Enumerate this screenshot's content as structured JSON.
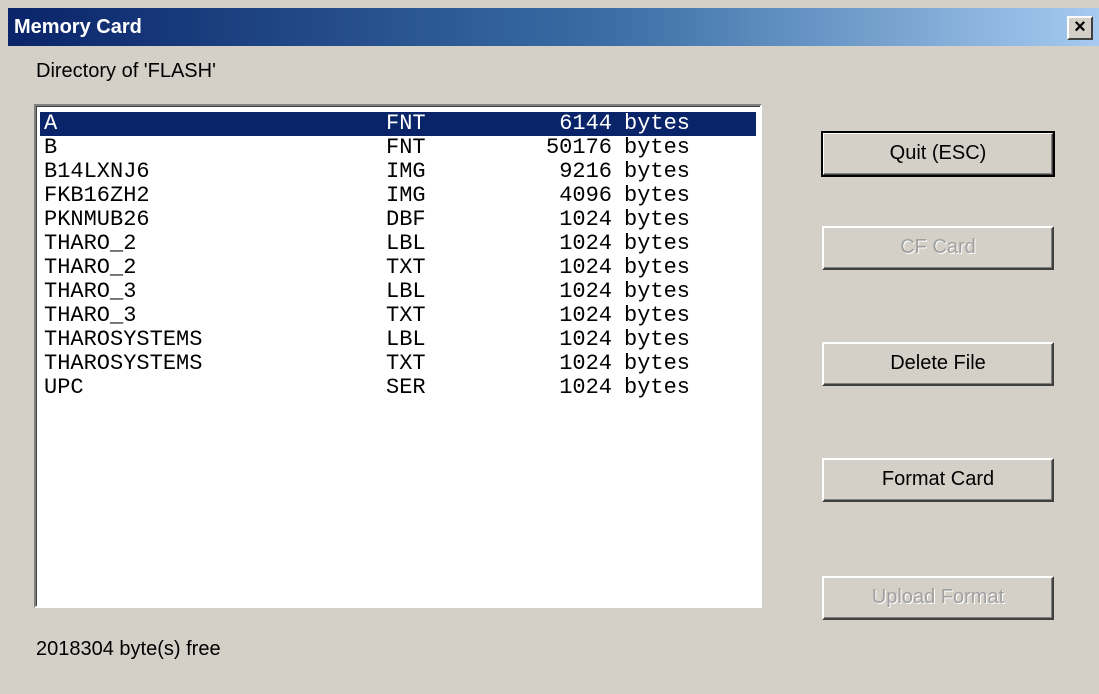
{
  "window": {
    "title": "Memory Card",
    "close_glyph": "×"
  },
  "directory_label": "Directory of 'FLASH'",
  "files": [
    {
      "name": "A",
      "ext": "FNT",
      "size": "6144",
      "unit": "bytes"
    },
    {
      "name": "B",
      "ext": "FNT",
      "size": "50176",
      "unit": "bytes"
    },
    {
      "name": "B14LXNJ6",
      "ext": "IMG",
      "size": "9216",
      "unit": "bytes"
    },
    {
      "name": "FKB16ZH2",
      "ext": "IMG",
      "size": "4096",
      "unit": "bytes"
    },
    {
      "name": "PKNMUB26",
      "ext": "DBF",
      "size": "1024",
      "unit": "bytes"
    },
    {
      "name": "THARO_2",
      "ext": "LBL",
      "size": "1024",
      "unit": "bytes"
    },
    {
      "name": "THARO_2",
      "ext": "TXT",
      "size": "1024",
      "unit": "bytes"
    },
    {
      "name": "THARO_3",
      "ext": "LBL",
      "size": "1024",
      "unit": "bytes"
    },
    {
      "name": "THARO_3",
      "ext": "TXT",
      "size": "1024",
      "unit": "bytes"
    },
    {
      "name": "THAROSYSTEMS",
      "ext": "LBL",
      "size": "1024",
      "unit": "bytes"
    },
    {
      "name": "THAROSYSTEMS",
      "ext": "TXT",
      "size": "1024",
      "unit": "bytes"
    },
    {
      "name": "UPC",
      "ext": "SER",
      "size": "1024",
      "unit": "bytes"
    }
  ],
  "buttons": {
    "quit": "Quit (ESC)",
    "cf_card": "CF Card",
    "delete_file": "Delete File",
    "format_card": "Format Card",
    "upload_format": "Upload Format"
  },
  "free_space": "2018304 byte(s) free",
  "colors": {
    "selection": "#0a246a",
    "face": "#d4d0c8",
    "disabled_text": "#a0a0a0"
  }
}
